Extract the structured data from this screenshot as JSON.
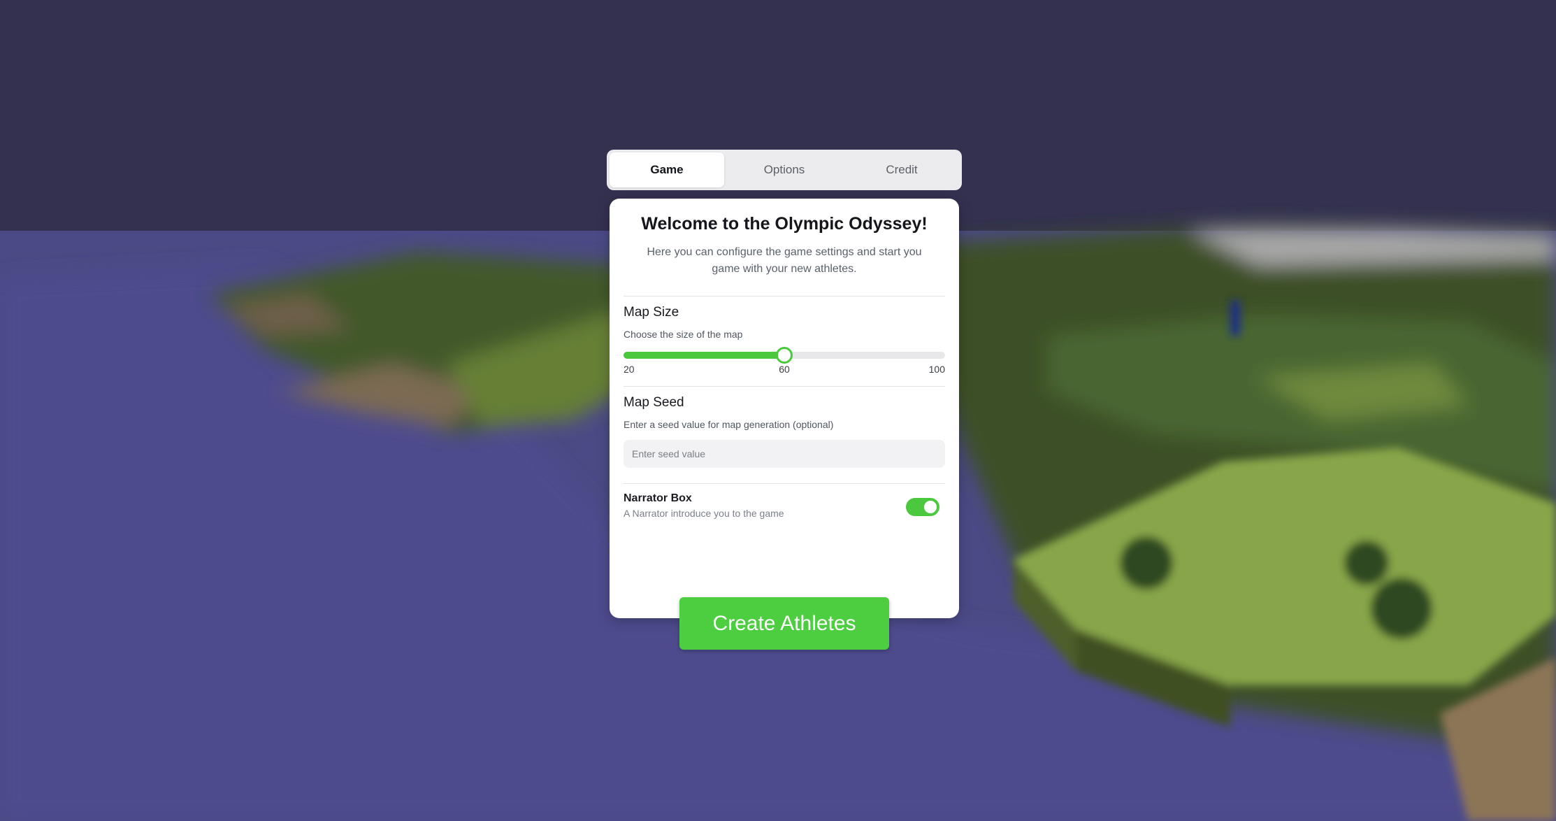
{
  "tabs": [
    {
      "label": "Game",
      "active": true
    },
    {
      "label": "Options",
      "active": false
    },
    {
      "label": "Credit",
      "active": false
    }
  ],
  "card": {
    "title": "Welcome to the Olympic Odyssey!",
    "subtitle": "Here you can configure the game settings and start you game with your new athletes."
  },
  "map_size": {
    "title": "Map Size",
    "hint": "Choose the size of the map",
    "min": 20,
    "max": 100,
    "value": 60,
    "min_label": "20",
    "value_label": "60",
    "max_label": "100"
  },
  "map_seed": {
    "title": "Map Seed",
    "hint": "Enter a seed value for map generation (optional)",
    "value": "",
    "placeholder": "Enter seed value"
  },
  "narrator": {
    "label": "Narrator Box",
    "description": "A Narrator introduce you to the game",
    "enabled": true
  },
  "primary_button": {
    "label": "Create Athletes"
  },
  "colors": {
    "accent": "#4cc83f",
    "sky": "#33314f",
    "water": "#4b4a86",
    "grass": "#536d2c",
    "sand": "#8a7356"
  }
}
